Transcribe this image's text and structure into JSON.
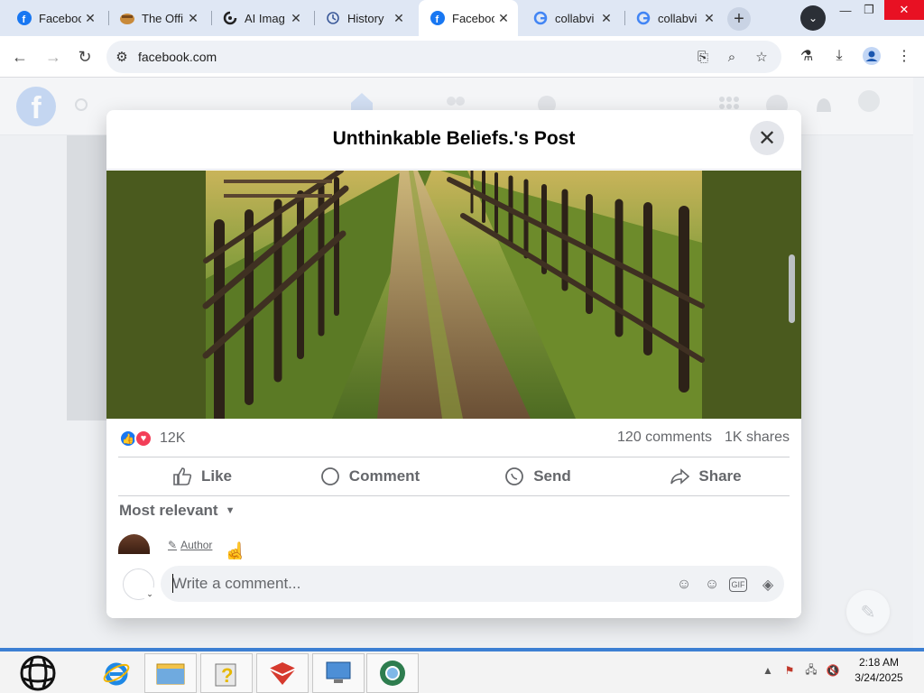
{
  "browser": {
    "tabs": [
      {
        "label": "Faceboo",
        "icon": "facebook-icon",
        "active": false
      },
      {
        "label": "The Offi",
        "icon": "the-office-icon",
        "active": false
      },
      {
        "label": "AI Imag",
        "icon": "ai-image-icon",
        "active": false
      },
      {
        "label": "History",
        "icon": "history-icon",
        "active": false
      },
      {
        "label": "Faceboo",
        "icon": "facebook-icon",
        "active": true
      },
      {
        "label": "collabvi",
        "icon": "google-icon",
        "active": false
      },
      {
        "label": "collabvi",
        "icon": "google-icon",
        "active": false
      }
    ],
    "url": "facebook.com"
  },
  "modal": {
    "title": "Unthinkable Beliefs.'s Post",
    "reaction_count": "12K",
    "comments_count": "120 comments",
    "shares_count": "1K shares",
    "actions": {
      "like": "Like",
      "comment": "Comment",
      "send": "Send",
      "share": "Share"
    },
    "sort_label": "Most relevant",
    "author_badge": "Author",
    "comment_placeholder": "Write a comment..."
  },
  "taskbar": {
    "time": "2:18 AM",
    "date": "3/24/2025"
  },
  "colors": {
    "facebook_blue": "#1877f2",
    "love_red": "#f33e58",
    "taskbar_accent": "#3c7fd3",
    "close_red": "#e81123"
  }
}
